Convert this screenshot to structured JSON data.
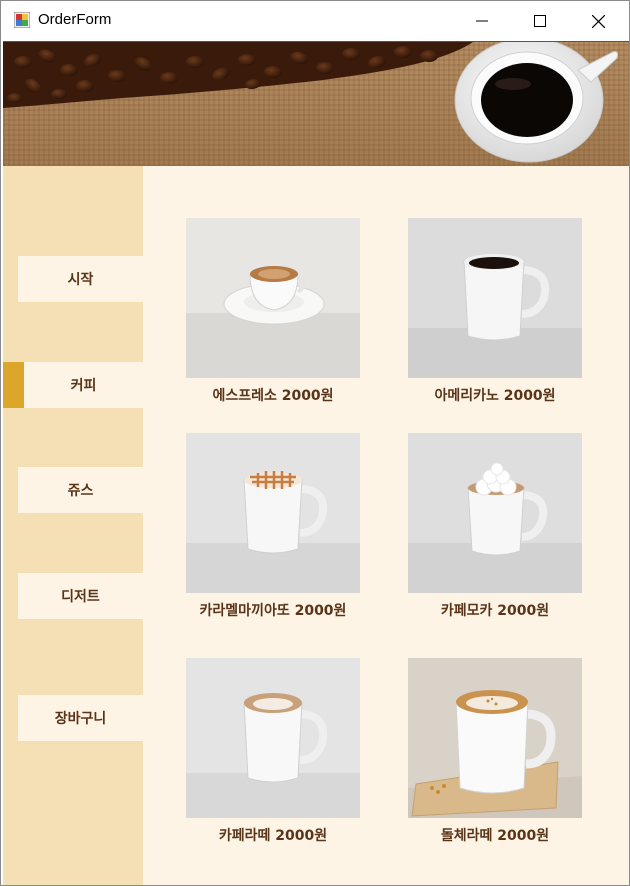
{
  "window": {
    "title": "OrderForm"
  },
  "colors": {
    "sidebar": "#f5dfb4",
    "content": "#fdf4e6",
    "accent": "#dba62a",
    "text": "#5a3418"
  },
  "icons": {
    "app": "app-icon",
    "minimize": "minimize-icon",
    "maximize": "maximize-icon",
    "close": "close-icon"
  },
  "sidebar": {
    "items": [
      {
        "label": "시작",
        "active": false
      },
      {
        "label": "커피",
        "active": true
      },
      {
        "label": "쥬스",
        "active": false
      },
      {
        "label": "디저트",
        "active": false
      },
      {
        "label": "장바구니",
        "active": false
      }
    ]
  },
  "menu": {
    "items": [
      {
        "caption": "에스프레소 2000원"
      },
      {
        "caption": "아메리카노 2000원"
      },
      {
        "caption": "카라멜마끼아또 2000원"
      },
      {
        "caption": "카페모카 2000원"
      },
      {
        "caption": "카페라떼 2000원"
      },
      {
        "caption": "돌체라떼 2000원"
      }
    ]
  }
}
